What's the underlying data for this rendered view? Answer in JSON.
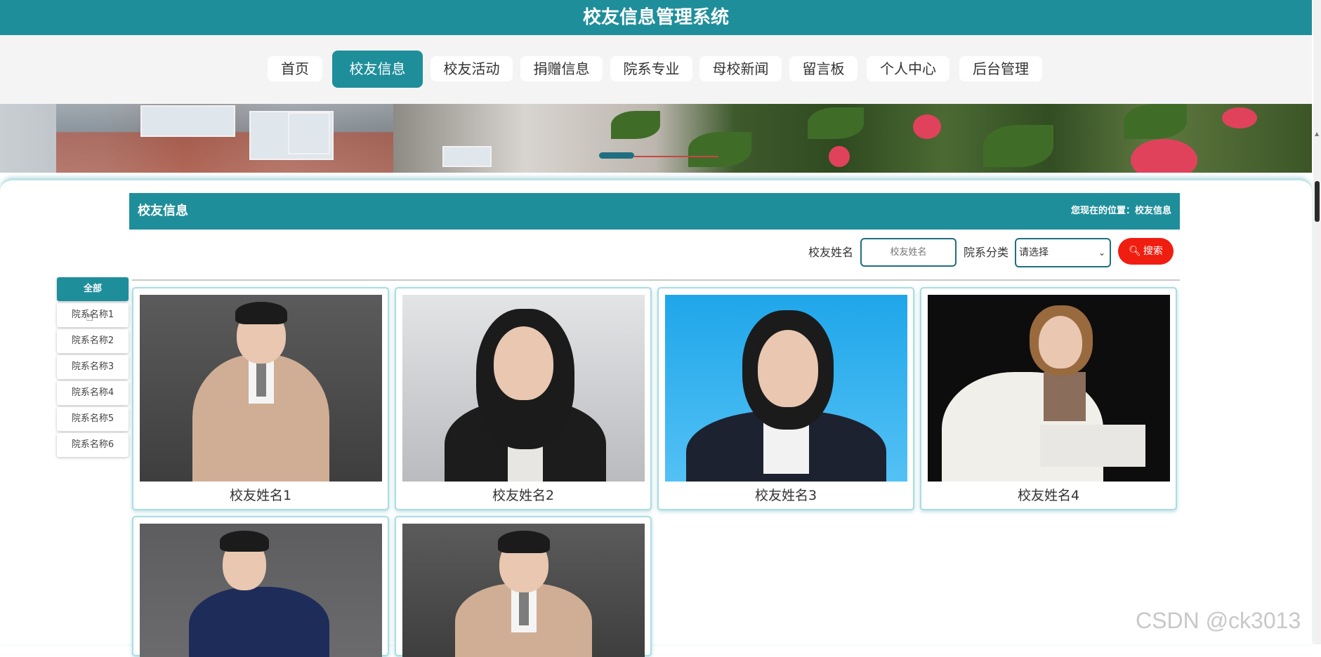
{
  "header": {
    "title": "校友信息管理系统"
  },
  "nav": {
    "items": [
      {
        "label": "首页"
      },
      {
        "label": "校友信息"
      },
      {
        "label": "校友活动"
      },
      {
        "label": "捐赠信息"
      },
      {
        "label": "院系专业"
      },
      {
        "label": "母校新闻"
      },
      {
        "label": "留言板"
      },
      {
        "label": "个人中心"
      },
      {
        "label": "后台管理"
      }
    ],
    "active_index": 1
  },
  "section": {
    "title": "校友信息",
    "breadcrumb": "您现在的位置：校友信息"
  },
  "search": {
    "name_label": "校友姓名",
    "name_placeholder": "校友姓名",
    "category_label": "院系分类",
    "category_selected": "请选择",
    "button_label": "搜索"
  },
  "categories": [
    {
      "label": "全部"
    },
    {
      "label": "院系名称1"
    },
    {
      "label": "院系名称2"
    },
    {
      "label": "院系名称3"
    },
    {
      "label": "院系名称4"
    },
    {
      "label": "院系名称5"
    },
    {
      "label": "院系名称6"
    }
  ],
  "alumni": [
    {
      "name": "校友姓名1"
    },
    {
      "name": "校友姓名2"
    },
    {
      "name": "校友姓名3"
    },
    {
      "name": "校友姓名4"
    },
    {
      "name": ""
    },
    {
      "name": ""
    }
  ],
  "watermark": "CSDN @ck3013",
  "colors": {
    "primary": "#1f8e9b",
    "search_button": "#f01e10"
  }
}
